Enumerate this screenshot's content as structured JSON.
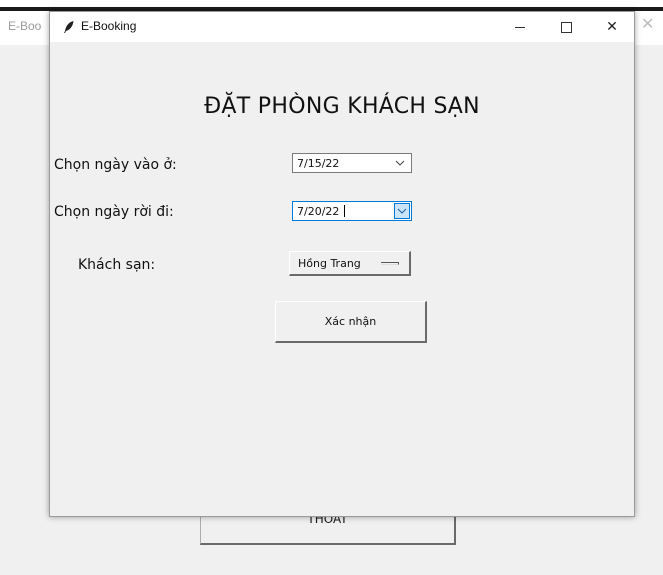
{
  "background_window": {
    "title": "E-Boo",
    "close_glyph": "✕",
    "exit_button_label": "THOÁT"
  },
  "window": {
    "title": "E-Booking",
    "icon": "feather-icon",
    "controls": {
      "minimize_glyph": "—",
      "close_glyph": "✕"
    }
  },
  "form": {
    "heading": "ĐẶT PHÒNG KHÁCH SẠN",
    "checkin_label": "Chọn ngày vào ở:",
    "checkin_value": "7/15/22",
    "checkout_label": "Chọn ngày rời đi:",
    "checkout_value": "7/20/22",
    "hotel_label": "Khách sạn:",
    "hotel_value": "Hồng Trang",
    "confirm_label": "Xác nhận"
  },
  "colors": {
    "window_bg": "#f0f0f0",
    "titlebar_bg": "#ffffff",
    "focus_accent": "#0078d7"
  }
}
